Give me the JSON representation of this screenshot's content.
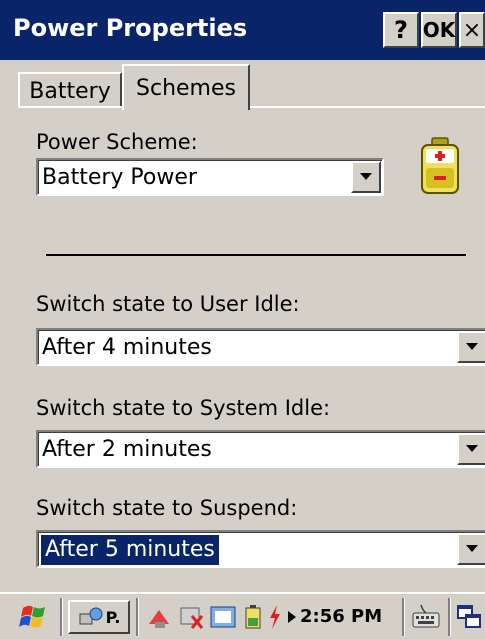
{
  "window": {
    "title": "Power Properties",
    "help_label": "?",
    "ok_label": "OK",
    "close_label": "×"
  },
  "tabs": [
    {
      "label": "Battery",
      "active": false
    },
    {
      "label": "Schemes",
      "active": true
    }
  ],
  "scheme": {
    "label": "Power Scheme:",
    "value": "Battery Power"
  },
  "settings": [
    {
      "label": "Switch state to User Idle:",
      "value": "After 4 minutes"
    },
    {
      "label": "Switch state to System Idle:",
      "value": "After 2 minutes"
    },
    {
      "label": "Switch state to Suspend:",
      "value": "After 5 minutes",
      "selected": true
    }
  ],
  "taskbar": {
    "task_label": "P.",
    "clock": "2:56 PM"
  },
  "colors": {
    "title_bar": "#0a246a",
    "selection": "#0a246a",
    "face": "#d4d0c8"
  },
  "icons": [
    "help-icon",
    "close-icon",
    "battery-icon",
    "dropdown-arrow-icon",
    "start-flag-icon",
    "keyboard-icon",
    "desktop-icon"
  ]
}
